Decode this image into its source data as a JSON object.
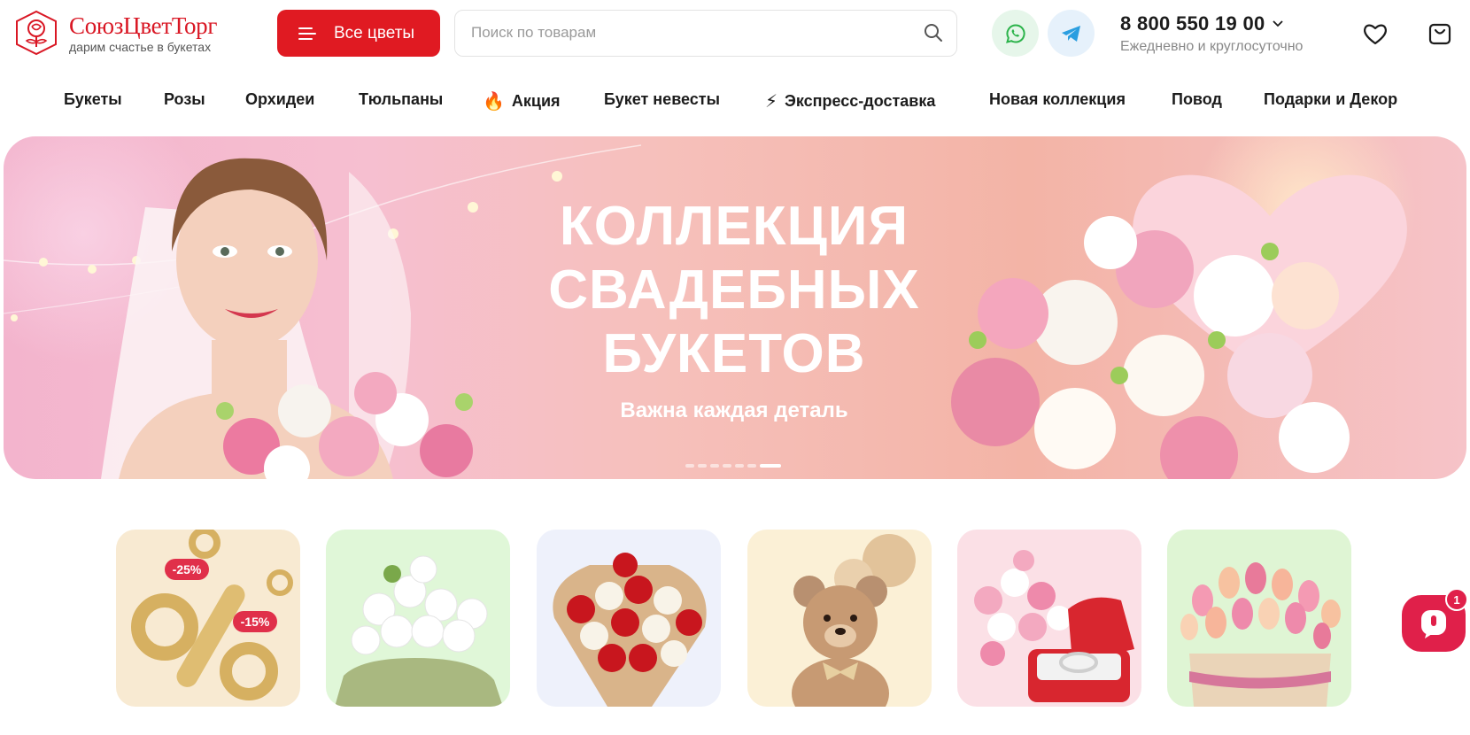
{
  "brand": {
    "name": "СоюзЦветТорг",
    "tagline": "дарим счастье в букетах",
    "color": "#d91724"
  },
  "header": {
    "catalog_label": "Все цветы",
    "search_placeholder": "Поиск по товарам",
    "phone": "8 800 550 19 00",
    "phone_hours": "Ежедневно и круглосуточно",
    "icons": [
      "whatsapp-icon",
      "telegram-icon",
      "heart-icon",
      "cart-icon"
    ]
  },
  "nav": {
    "items": [
      {
        "label": "Букеты"
      },
      {
        "label": "Розы"
      },
      {
        "label": "Орхидеи"
      },
      {
        "label": "Тюльпаны"
      },
      {
        "label": "Акция",
        "icon": "🔥"
      },
      {
        "label": "Букет невесты"
      },
      {
        "label": "Экспресс-доставка",
        "icon": "⚡"
      },
      {
        "label": "Новая коллекция"
      },
      {
        "label": "Повод"
      },
      {
        "label": "Подарки и Декор"
      }
    ]
  },
  "hero": {
    "title_line1": "КОЛЛЕКЦИЯ",
    "title_line2": "СВАДЕБНЫХ",
    "title_line3": "БУКЕТОВ",
    "subtitle": "Важна каждая деталь",
    "slide_count": 7,
    "active_slide": 7
  },
  "categories": [
    {
      "name": "sale",
      "badges": [
        "-25%",
        "-15%"
      ]
    },
    {
      "name": "white-roses"
    },
    {
      "name": "red-white-roses"
    },
    {
      "name": "teddy-bear"
    },
    {
      "name": "ring-and-bouquet"
    },
    {
      "name": "tulips-box"
    }
  ],
  "chat": {
    "badge_count": "1"
  },
  "colors": {
    "accent": "#e01a22",
    "chat": "#e0204a"
  }
}
